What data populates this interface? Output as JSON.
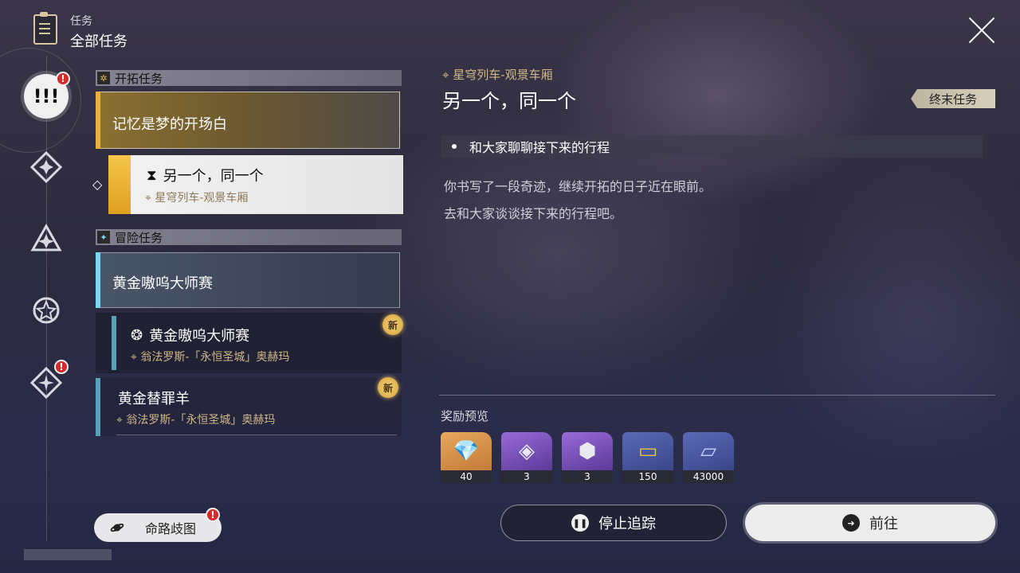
{
  "header": {
    "small_label": "任务",
    "title": "全部任务"
  },
  "rail": {
    "active_badge": "!",
    "badge2": "!"
  },
  "sections": {
    "trailblaze": "开拓任务",
    "adventure": "冒险任务"
  },
  "quests": {
    "main_title": "记忆是梦的开场白",
    "selected": {
      "title": "另一个，同一个",
      "location": "星穹列车-观景车厢"
    },
    "adventure_title": "黄金嗷呜大师赛",
    "adv_sub": {
      "title": "黄金嗷呜大师赛",
      "location": "翁法罗斯-「永恒圣城」奥赫玛",
      "badge": "新"
    },
    "scapegoat": {
      "title": "黄金替罪羊",
      "location": "翁法罗斯-「永恒圣城」奥赫玛",
      "badge": "新"
    }
  },
  "route_button": {
    "label": "命路歧图",
    "badge": "!"
  },
  "detail": {
    "location": "星穹列车-观景车厢",
    "title": "另一个，同一个",
    "tag": "终末任务",
    "objective": "和大家聊聊接下来的行程",
    "desc_line1": "你书写了一段奇迹，继续开拓的日子近在眼前。",
    "desc_line2": "去和大家谈谈接下来的行程吧。",
    "reward_label": "奖励预览",
    "rewards": [
      {
        "count": "40",
        "icon": "crystal-icon"
      },
      {
        "count": "3",
        "icon": "purple-material-icon"
      },
      {
        "count": "3",
        "icon": "purple-relic-icon"
      },
      {
        "count": "150",
        "icon": "gold-ticket-icon"
      },
      {
        "count": "43000",
        "icon": "exp-card-icon"
      }
    ],
    "stop_label": "停止追踪",
    "go_label": "前往"
  }
}
